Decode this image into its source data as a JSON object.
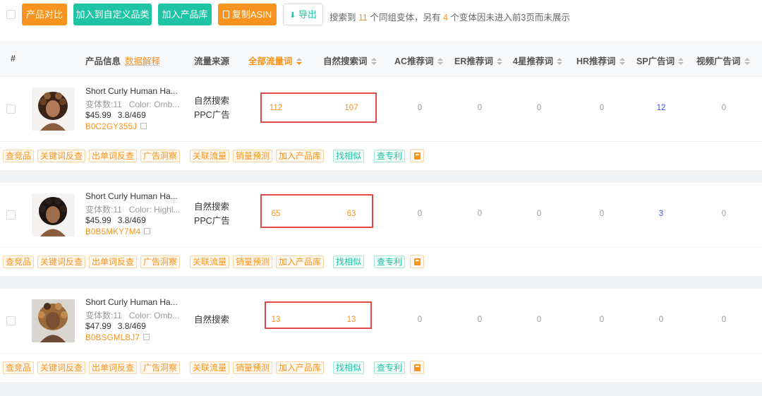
{
  "toolbar": {
    "compare": "产品对比",
    "add_category": "加入到自定义品类",
    "add_library": "加入产品库",
    "copy_asin": "复制ASIN",
    "export": "导出",
    "summary": {
      "prefix": "搜索到",
      "count": "11",
      "mid": "个同组变体，另有",
      "hidden": "4",
      "suffix": "个变体因未进入前3页而未展示"
    }
  },
  "header": {
    "index": "#",
    "product_info": "产品信息",
    "data_explain": "数据解释",
    "traffic_source": "流量来源",
    "all_traffic": "全部流量词",
    "organic": "自然搜索词",
    "ac": "AC推荐词",
    "er": "ER推荐词",
    "four_star": "4星推荐词",
    "hr": "HR推荐词",
    "sp": "SP广告词",
    "video": "视频广告词"
  },
  "actions": [
    "查竞品",
    "关键词反查",
    "出单词反查",
    "广告洞察",
    "关联流量",
    "销量预测",
    "加入产品库",
    "找相似",
    "查专利"
  ],
  "products": [
    {
      "title": "Short Curly Human Ha...",
      "variants": "变体数:11",
      "color": "Color: Omb...",
      "price": "$45.99",
      "rating": "3.8/469",
      "asin": "B0C2GY355J",
      "sources": [
        "自然搜索",
        "PPC广告"
      ],
      "all_traffic": "112",
      "organic": "107",
      "ac": "0",
      "er": "0",
      "four_star": "0",
      "hr": "0",
      "sp": "12",
      "video": "0"
    },
    {
      "title": "Short Curly Human Ha...",
      "variants": "变体数:11",
      "color": "Color: Highl...",
      "price": "$45.99",
      "rating": "3.8/469",
      "asin": "B0B5MKY7M4",
      "sources": [
        "自然搜索",
        "PPC广告"
      ],
      "all_traffic": "65",
      "organic": "63",
      "ac": "0",
      "er": "0",
      "four_star": "0",
      "hr": "0",
      "sp": "3",
      "video": "0"
    },
    {
      "title": "Short Curly Human Ha...",
      "variants": "变体数:11",
      "color": "Color: Omb...",
      "price": "$47.99",
      "rating": "3.8/469",
      "asin": "B0BSGMLBJ7",
      "sources": [
        "自然搜索"
      ],
      "all_traffic": "13",
      "organic": "13",
      "ac": "0",
      "er": "0",
      "four_star": "0",
      "hr": "0",
      "sp": "0",
      "video": "0"
    }
  ]
}
